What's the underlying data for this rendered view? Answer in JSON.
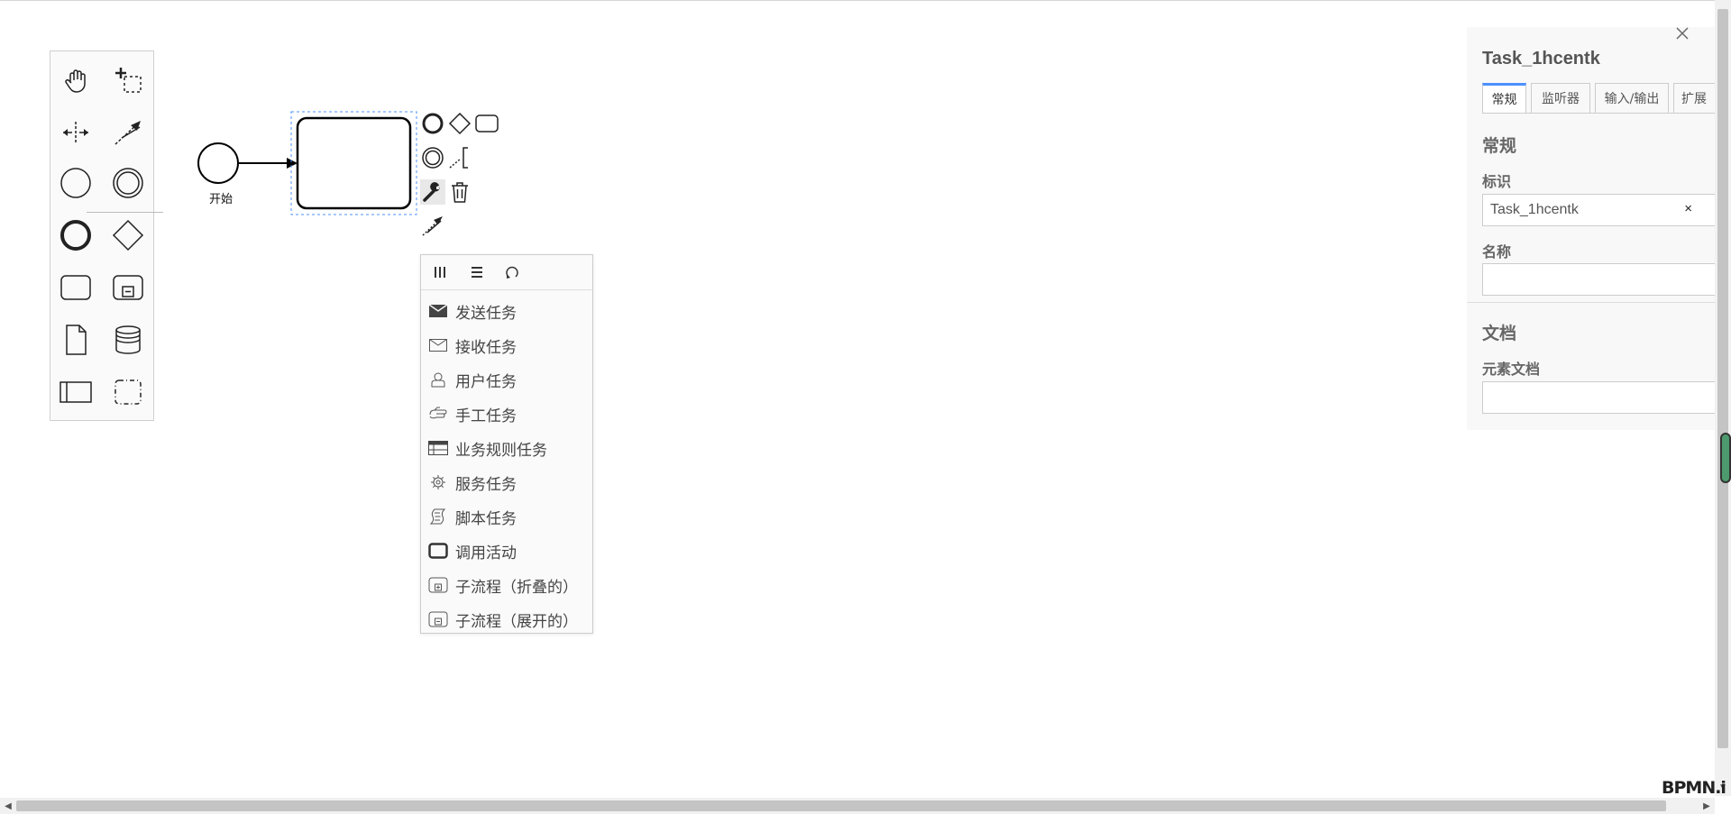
{
  "palette": {
    "tools": [
      {
        "name": "hand-tool-icon"
      },
      {
        "name": "lasso-tool-icon"
      },
      {
        "name": "space-tool-icon"
      },
      {
        "name": "global-connect-tool-icon"
      }
    ],
    "shapes": [
      {
        "name": "start-event-icon"
      },
      {
        "name": "intermediate-event-icon"
      },
      {
        "name": "end-event-icon"
      },
      {
        "name": "exclusive-gateway-icon"
      },
      {
        "name": "task-icon"
      },
      {
        "name": "subprocess-expanded-icon"
      },
      {
        "name": "data-object-icon"
      },
      {
        "name": "data-store-icon"
      },
      {
        "name": "participant-pool-icon"
      },
      {
        "name": "group-icon"
      }
    ]
  },
  "canvas": {
    "start_event_label": "开始",
    "selected_element": "Task_1hcentk"
  },
  "context_pad": [
    "append-end-event-icon",
    "append-gateway-icon",
    "append-task-icon",
    "append-intermediate-event-icon",
    "append-text-annotation-icon",
    "replace-wrench-icon",
    "delete-trash-icon",
    "connect-icon"
  ],
  "replace_menu": {
    "header_buttons": [
      "parallel-multi-instance-icon",
      "sequential-multi-instance-icon",
      "loop-icon"
    ],
    "items": [
      {
        "label": "发送任务",
        "icon": "send-task-icon"
      },
      {
        "label": "接收任务",
        "icon": "receive-task-icon"
      },
      {
        "label": "用户任务",
        "icon": "user-task-icon"
      },
      {
        "label": "手工任务",
        "icon": "manual-task-icon"
      },
      {
        "label": "业务规则任务",
        "icon": "business-rule-task-icon"
      },
      {
        "label": "服务任务",
        "icon": "service-task-icon"
      },
      {
        "label": "脚本任务",
        "icon": "script-task-icon"
      },
      {
        "label": "调用活动",
        "icon": "call-activity-icon"
      },
      {
        "label": "子流程（折叠的）",
        "icon": "subprocess-collapsed-icon"
      },
      {
        "label": "子流程（展开的）",
        "icon": "subprocess-expanded-icon"
      }
    ]
  },
  "properties": {
    "title": "Task_1hcentk",
    "tabs": [
      "常规",
      "监听器",
      "输入/输出",
      "扩展"
    ],
    "active_tab": "常规",
    "general_group": "常规",
    "id_label": "标识",
    "id_value": "Task_1hcentk",
    "id_clear": "×",
    "name_label": "名称",
    "name_value": "",
    "doc_group": "文档",
    "doc_label": "元素文档",
    "doc_value": ""
  },
  "watermark": "BPMN.i",
  "colors": {
    "selection": "#4d90fe",
    "shape_stroke": "#000000",
    "panel_bg": "#f8f8f8",
    "active_tab_accent": "#4d90fe"
  }
}
